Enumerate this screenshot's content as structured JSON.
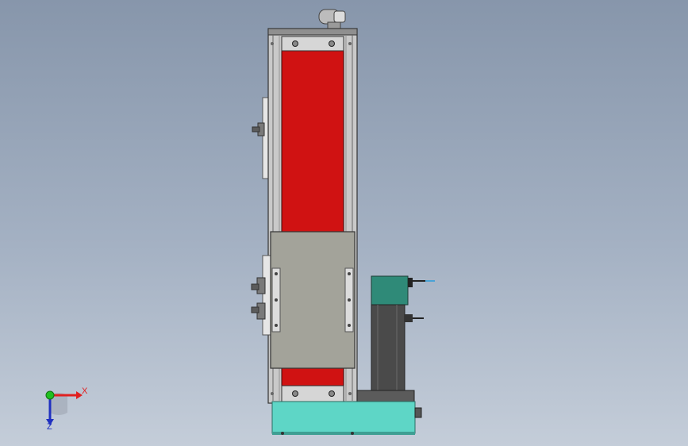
{
  "viewport": {
    "background_top": "#8796ab",
    "background_bottom": "#c4cdd9"
  },
  "model": {
    "description_icon": "linear-actuator-module-icon",
    "colors": {
      "frame": "#c9c9c9",
      "belt_cover": "#d01212",
      "carriage": "#a3a39a",
      "motor_body": "#4a4a4a",
      "motor_head": "#2f8a78",
      "base": "#5ed6c6"
    }
  },
  "triad": {
    "x_label": "X",
    "z_label": "Z",
    "x_color": "#e02020",
    "y_color": "#20c020",
    "z_color": "#2030c0"
  }
}
